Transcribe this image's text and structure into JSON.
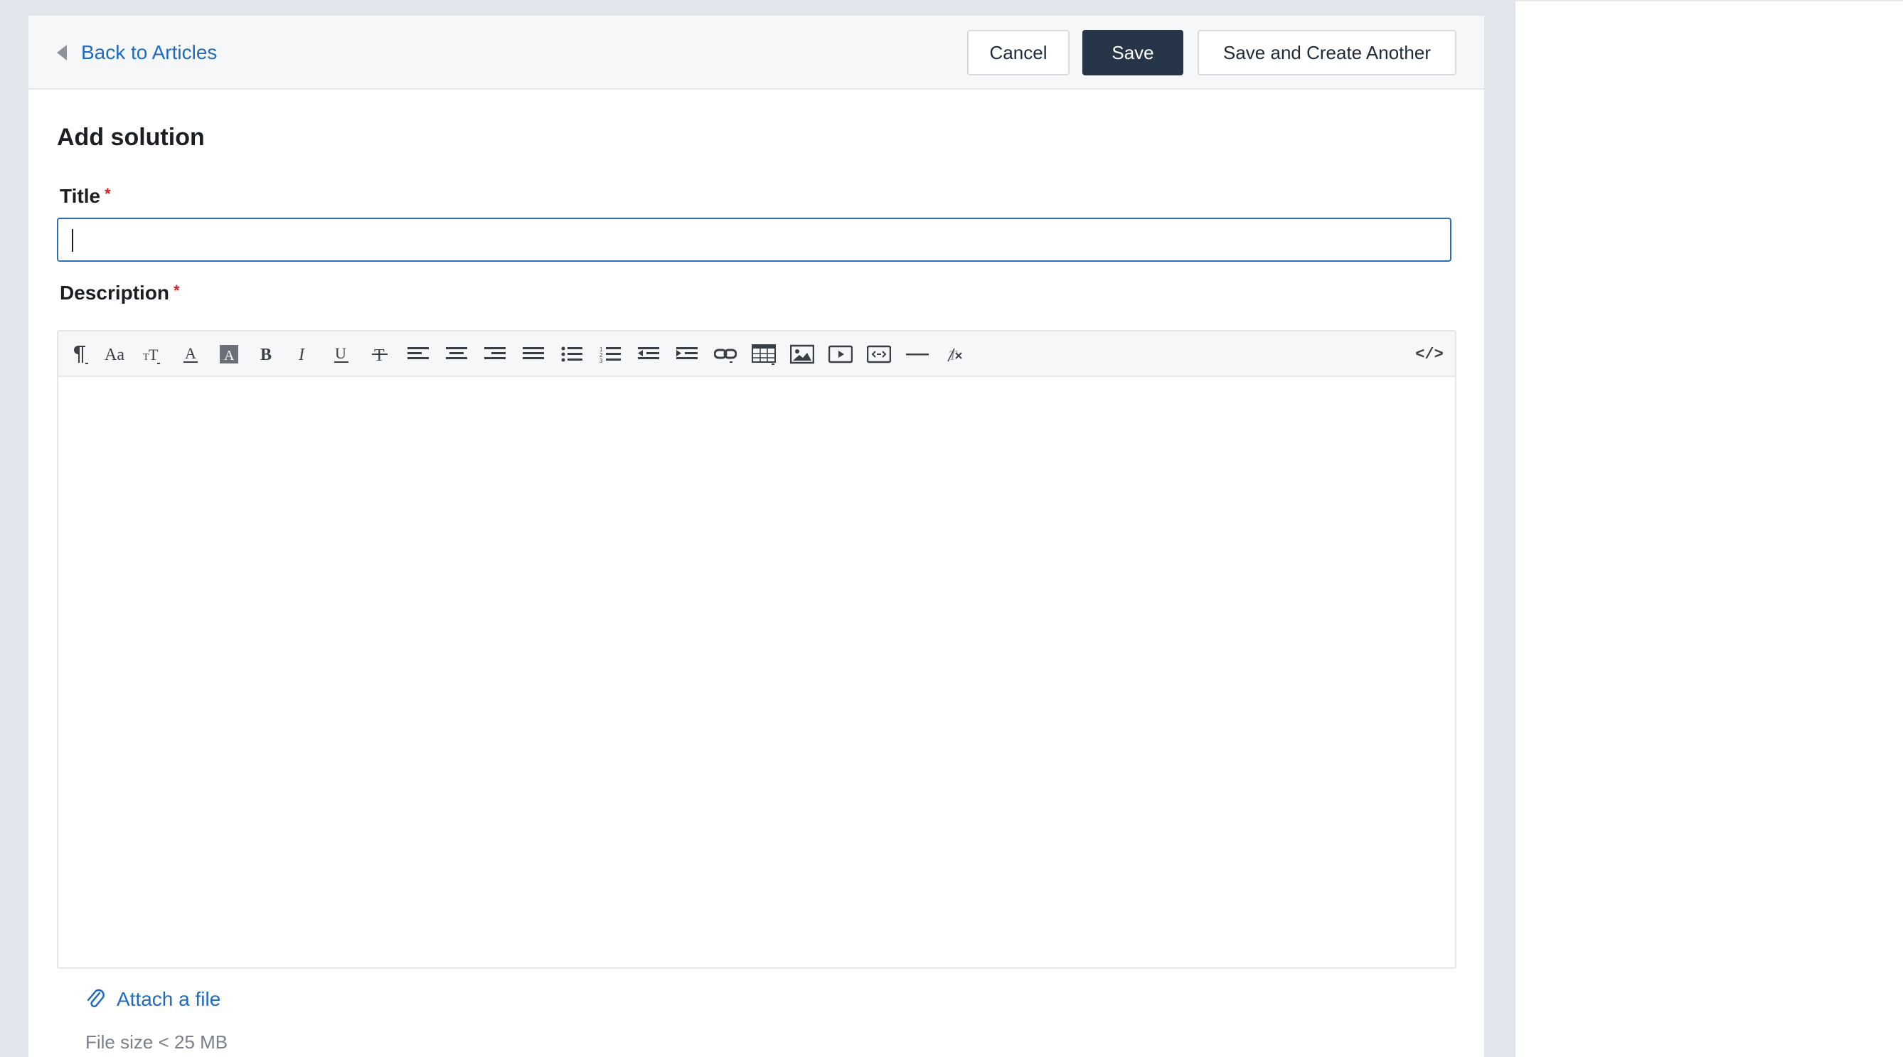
{
  "header": {
    "back_label": "Back to Articles",
    "cancel_label": "Cancel",
    "save_label": "Save",
    "save_another_label": "Save and Create Another"
  },
  "form": {
    "title": "Add solution",
    "title_field": {
      "label": "Title",
      "required_mark": "*",
      "value": "",
      "placeholder": ""
    },
    "description_field": {
      "label": "Description",
      "required_mark": "*"
    },
    "attach_label": "Attach a file",
    "file_size_note": "File size < 25 MB"
  },
  "toolbar": {
    "icons": [
      "paragraph-format-icon",
      "font-family-icon",
      "font-size-icon",
      "text-color-icon",
      "background-color-icon",
      "bold-icon",
      "italic-icon",
      "underline-icon",
      "strikethrough-icon",
      "align-left-icon",
      "align-center-icon",
      "align-right-icon",
      "align-justify-icon",
      "bullet-list-icon",
      "numbered-list-icon",
      "outdent-icon",
      "indent-icon",
      "insert-link-icon",
      "insert-table-icon",
      "insert-image-icon",
      "insert-video-icon",
      "embed-code-icon",
      "horizontal-rule-icon",
      "clear-formatting-icon",
      "code-view-icon"
    ],
    "code_view_label": "</>"
  },
  "colors": {
    "link": "#1f6bc2",
    "primary_button": "#263548",
    "required": "#d21f26",
    "input_focus_border": "#2a6fb5",
    "page_background": "#e1e5ec"
  }
}
